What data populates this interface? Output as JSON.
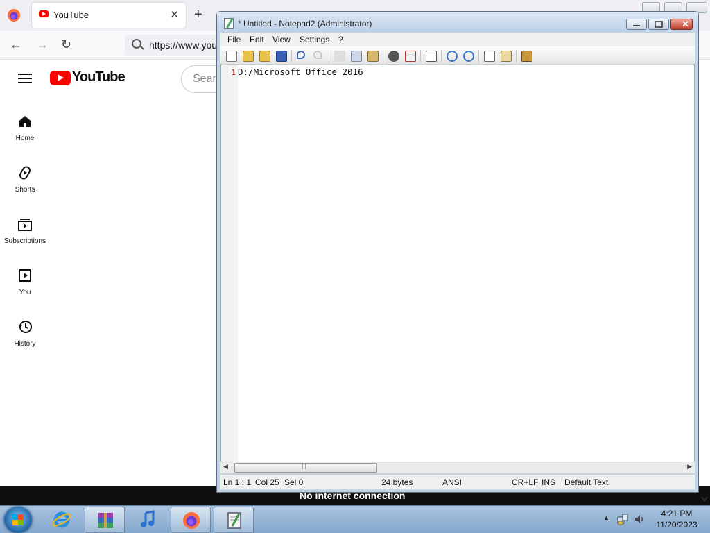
{
  "browser": {
    "tab_title": "YouTube",
    "tab_close": "✕",
    "new_tab": "+",
    "url": "https://www.yout",
    "back_glyph": "←",
    "forward_glyph": "→",
    "reload_glyph": "↻"
  },
  "youtube": {
    "logo_text": "YouTube",
    "search_placeholder": "Searc",
    "sidebar": [
      {
        "label": "Home",
        "icon": "home-icon"
      },
      {
        "label": "Shorts",
        "icon": "shorts-icon"
      },
      {
        "label": "Subscriptions",
        "icon": "subscriptions-icon"
      },
      {
        "label": "You",
        "icon": "you-icon"
      },
      {
        "label": "History",
        "icon": "history-icon"
      }
    ],
    "offline_message": "No internet connection"
  },
  "notepad": {
    "title": "* Untitled - Notepad2 (Administrator)",
    "menu": [
      "File",
      "Edit",
      "View",
      "Settings",
      "?"
    ],
    "line_number": "1",
    "content": "D:/Microsoft Office 2016",
    "status": {
      "position": "Ln 1 : 1",
      "column": "Col 25",
      "selection": "Sel 0",
      "size": "24 bytes",
      "encoding": "ANSI",
      "line_endings": "CR+LF",
      "mode": "INS",
      "scheme": "Default Text"
    }
  },
  "taskbar": {
    "apps": [
      "internet-explorer",
      "winrar",
      "itunes",
      "firefox",
      "notepad2"
    ],
    "time": "4:21 PM",
    "date": "11/20/2023"
  },
  "colors": {
    "youtube_red": "#ff0000",
    "notepad_title": "#c5d5e8",
    "taskbar": "#95b4d6"
  }
}
